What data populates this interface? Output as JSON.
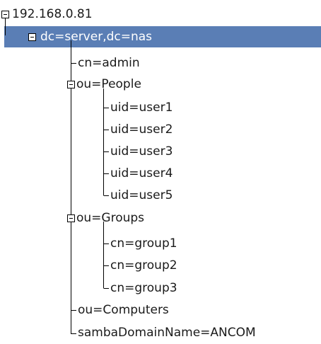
{
  "tree": {
    "root": {
      "label": "192.168.0.81",
      "expanded": true
    },
    "base": {
      "label": "dc=server,dc=nas",
      "expanded": true,
      "selected": true
    },
    "admin": {
      "label": "cn=admin"
    },
    "people": {
      "label": "ou=People",
      "expanded": true,
      "children": [
        "uid=user1",
        "uid=user2",
        "uid=user3",
        "uid=user4",
        "uid=user5"
      ]
    },
    "groups": {
      "label": "ou=Groups",
      "expanded": true,
      "children": [
        "cn=group1",
        "cn=group2",
        "cn=group3"
      ]
    },
    "computers": {
      "label": "ou=Computers"
    },
    "samba": {
      "label": "sambaDomainName=ANCOM"
    }
  },
  "colors": {
    "selection": "#5a7eb5",
    "text": "#1a1a1a",
    "selected_text": "#ffffff"
  },
  "icons": {
    "expand_toggle": "minus-box-icon"
  }
}
